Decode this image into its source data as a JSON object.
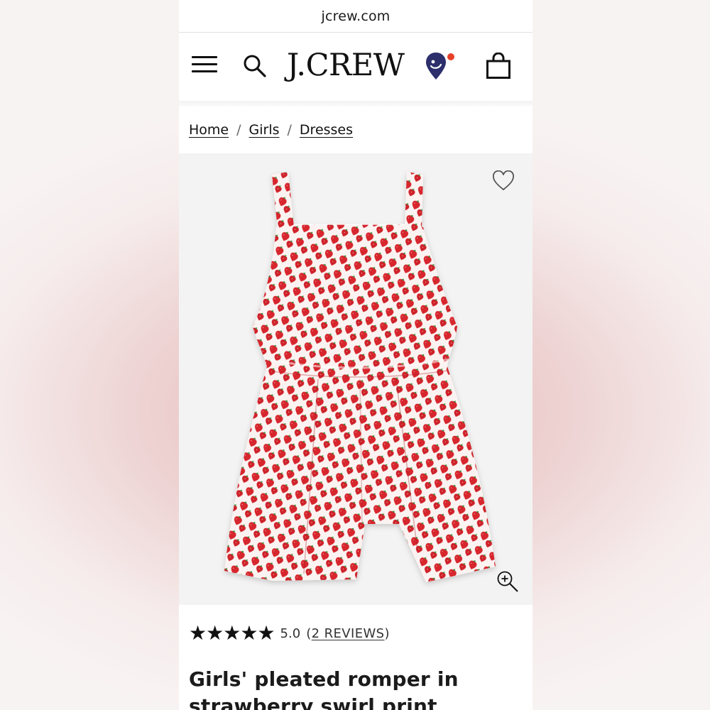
{
  "browser": {
    "url": "jcrew.com"
  },
  "header": {
    "logo": "J.CREW",
    "icons": [
      "menu-icon",
      "search-icon",
      "store-locator-icon",
      "shopping-bag-icon"
    ],
    "accent_dot_color": "#e5402a"
  },
  "breadcrumb": {
    "items": [
      {
        "label": "Home"
      },
      {
        "label": "Girls"
      },
      {
        "label": "Dresses"
      }
    ],
    "separator": "/"
  },
  "product": {
    "image_description": "red strawberry print pleated romper",
    "print_colors": {
      "fabric": "#fbf3f1",
      "berry": "#d7262d",
      "leaf": "#3f8a3a"
    },
    "rating": {
      "stars": 5,
      "star_glyph": "★",
      "score": "5.0",
      "open_paren": "(",
      "reviews_label": "2 REVIEWS",
      "close_paren": ")"
    },
    "title": "Girls' pleated romper in strawberry swirl print"
  }
}
